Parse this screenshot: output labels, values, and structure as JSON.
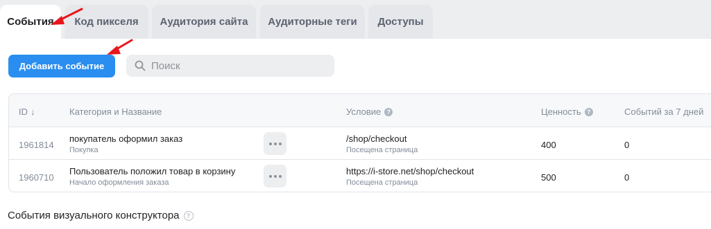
{
  "tabs": [
    {
      "label": "События",
      "active": true
    },
    {
      "label": "Код пикселя",
      "active": false
    },
    {
      "label": "Аудитория сайта",
      "active": false
    },
    {
      "label": "Аудиторные теги",
      "active": false
    },
    {
      "label": "Доступы",
      "active": false
    }
  ],
  "toolbar": {
    "add_event_label": "Добавить событие",
    "search_placeholder": "Поиск",
    "accent_color": "#2a8ef0"
  },
  "table": {
    "columns": {
      "id": "ID",
      "id_sort": "↓",
      "name": "Категория и Название",
      "condition": "Условие",
      "value": "Ценность",
      "count": "Событий за 7 дней"
    },
    "rows": [
      {
        "id": "1961814",
        "name": "покупатель оформил заказ",
        "category": "Покупка",
        "condition": "/shop/checkout",
        "condition_type": "Посещена страница",
        "value": "400",
        "count": "0"
      },
      {
        "id": "1960710",
        "name": "Пользователь положил товар в корзину",
        "category": "Начало оформления заказа",
        "condition": "https://i-store.net/shop/checkout",
        "condition_type": "Посещена страница",
        "value": "500",
        "count": "0"
      }
    ]
  },
  "section": {
    "visual_builder_title": "События визуального конструктора"
  },
  "annotations": {
    "arrow_color": "#e8161b"
  }
}
